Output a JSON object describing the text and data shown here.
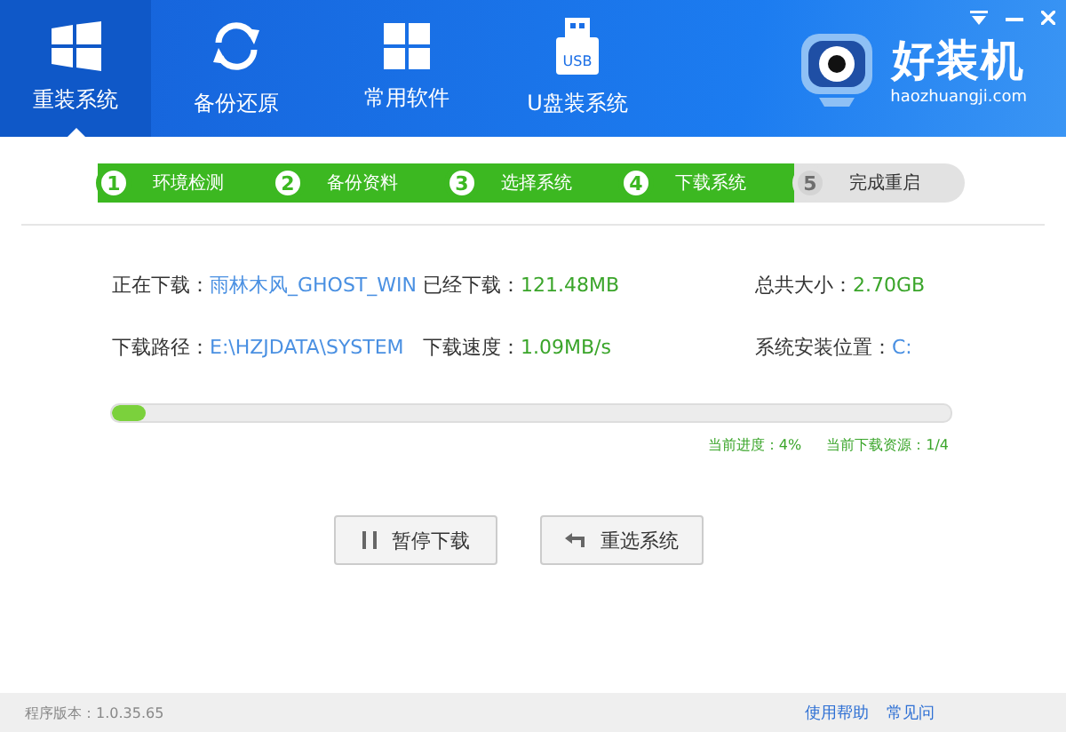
{
  "nav": [
    {
      "label": "重装系统",
      "selected": true,
      "kind": "windows"
    },
    {
      "label": "备份还原",
      "selected": false,
      "kind": "sync"
    },
    {
      "label": "常用软件",
      "selected": false,
      "kind": "grid"
    },
    {
      "label": "U盘装系统",
      "selected": false,
      "kind": "usb"
    }
  ],
  "usb_label": "USB",
  "brand": {
    "name": "好装机",
    "url": "haozhuangji.com"
  },
  "steps": [
    {
      "number": "1",
      "label": "环境检测",
      "done": true
    },
    {
      "number": "2",
      "label": "备份资料",
      "done": true
    },
    {
      "number": "3",
      "label": "选择系统",
      "done": true
    },
    {
      "number": "4",
      "label": "下载系统",
      "done": true
    },
    {
      "number": "5",
      "label": "完成重启",
      "done": false
    }
  ],
  "info": [
    [
      {
        "label": "正在下载：",
        "value": "雨林木风_GHOST_WIN",
        "kind": "link"
      },
      {
        "label": "已经下载：",
        "value": "121.48MB",
        "kind": "stat"
      },
      {
        "label": "总共大小：",
        "value": "2.70GB",
        "kind": "stat"
      }
    ],
    [
      {
        "label": "下载路径：",
        "value": "E:\\HZJDATA\\SYSTEM",
        "kind": "link"
      },
      {
        "label": "下载速度：",
        "value": "1.09MB/s",
        "kind": "stat"
      },
      {
        "label": "系统安装位置：",
        "value": "C:",
        "kind": "link"
      }
    ]
  ],
  "progress": {
    "level": 0.04,
    "progress_label": "当前进度：",
    "progress_value": "4%",
    "source_label": "当前下载资源：",
    "source_value": "1/4"
  },
  "buttons": [
    {
      "label": "暂停下载",
      "kind": "pause"
    },
    {
      "label": "重选系统",
      "kind": "back"
    }
  ],
  "footer": {
    "version": "程序版本：1.0.35.65",
    "links": [
      "使用帮助",
      "常见问"
    ]
  }
}
